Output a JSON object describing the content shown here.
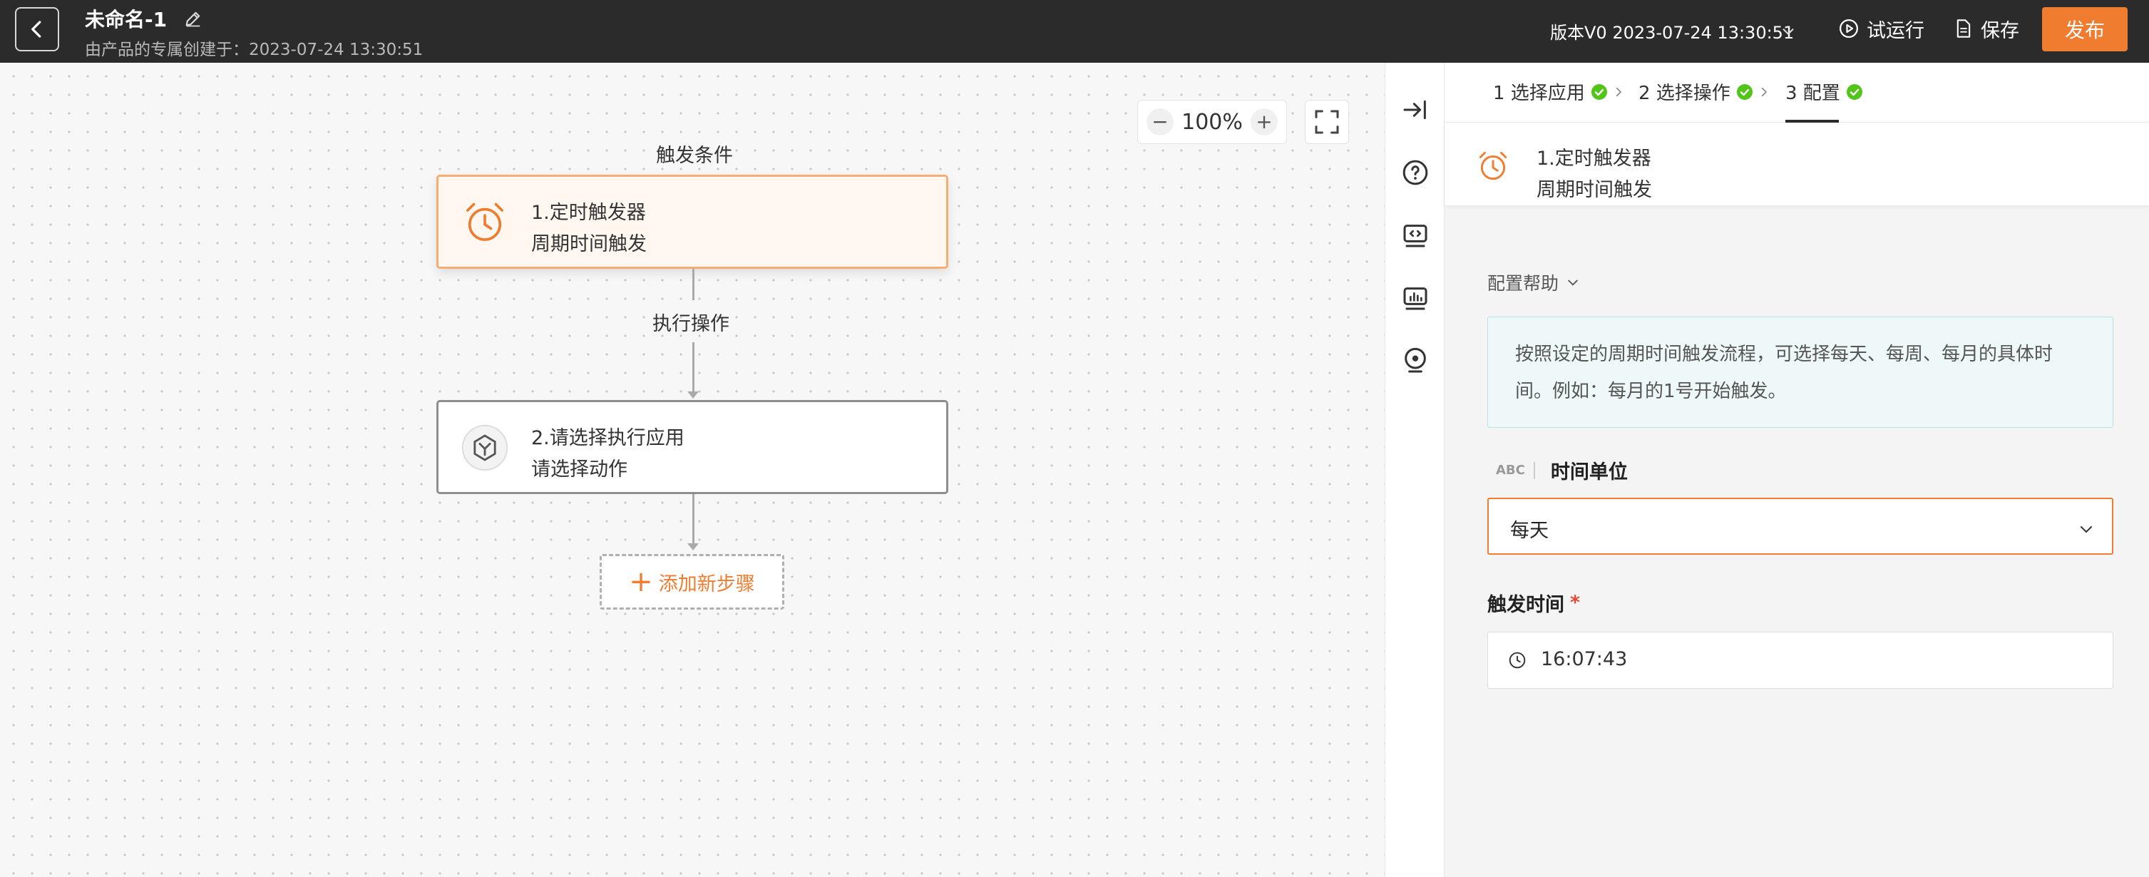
{
  "header": {
    "title": "未命名-1",
    "subtitle": "由产品的专属创建于：2023-07-24 13:30:51",
    "version": "版本V0 2023-07-24 13:30:51",
    "run_label": "试运行",
    "save_label": "保存",
    "publish_label": "发布"
  },
  "canvas": {
    "zoom_level": "100%",
    "zoom_out": "−",
    "zoom_in": "+",
    "trigger_section_label": "触发条件",
    "exec_section_label": "执行操作",
    "nodes": [
      {
        "title": "1.定时触发器",
        "subtitle": "周期时间触发",
        "icon": "alarm-clock-icon"
      },
      {
        "title": "2.请选择执行应用",
        "subtitle": "请选择动作",
        "icon": "app-cube-icon"
      }
    ],
    "add_step_label": "添加新步骤",
    "add_step_plus": "+"
  },
  "rail": {
    "icons": [
      "collapse-panel-icon",
      "help-icon",
      "code-icon",
      "log-icon",
      "location-icon"
    ]
  },
  "panel": {
    "steps": [
      {
        "label": "1 选择应用",
        "done": true
      },
      {
        "label": "2 选择操作",
        "done": true
      },
      {
        "label": "3 配置",
        "done": true,
        "active": true
      }
    ],
    "summary": {
      "title": "1.定时触发器",
      "subtitle": "周期时间触发"
    },
    "help_label": "配置帮助",
    "help_text": "按照设定的周期时间触发流程，可选择每天、每周、每月的具体时间。例如：每月的1号开始触发。",
    "unit_field": {
      "type_badge": "ABC",
      "label": "时间单位",
      "value": "每天"
    },
    "time_field": {
      "label": "触发时间",
      "required_mark": "*",
      "value": "16:07:43"
    }
  },
  "colors": {
    "accent": "#ef7c2f",
    "topbar": "#2b2b2b",
    "success": "#52c41a",
    "help_bg": "#eef8f8"
  }
}
